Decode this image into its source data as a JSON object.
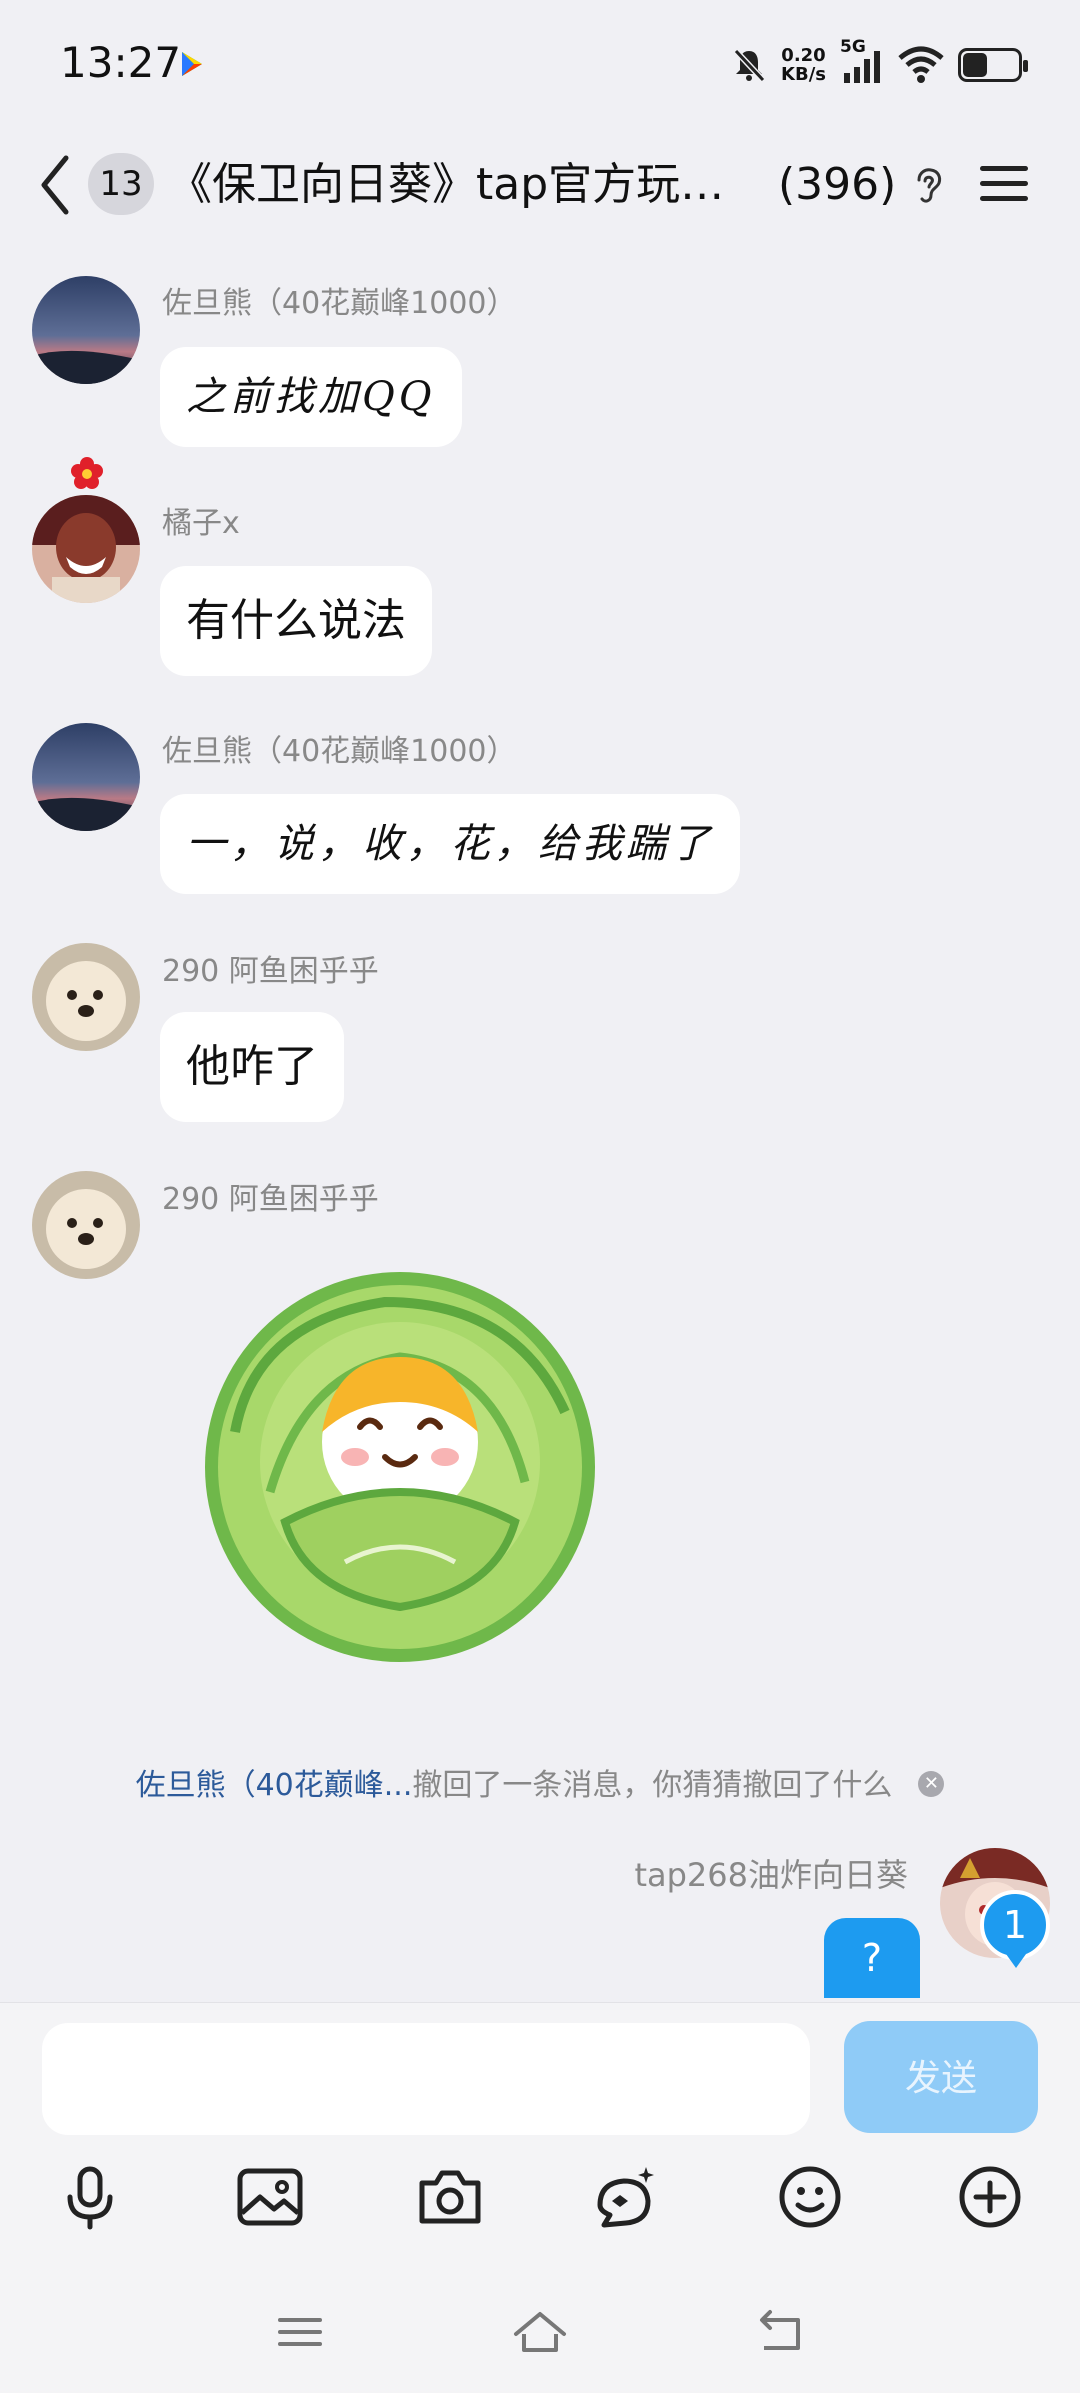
{
  "status_bar": {
    "time": "13:27",
    "net_speed_value": "0.20",
    "net_speed_unit": "KB/s",
    "network_type": "5G",
    "battery_level": 0.45
  },
  "header": {
    "unread_count": "13",
    "title": "《保卫向日葵》tap官方玩家…",
    "member_count": "(396)"
  },
  "messages": [
    {
      "sender": "佐旦熊（40花巅峰1000）",
      "text": "之前找加QQ"
    },
    {
      "sender": "橘子x",
      "text": "有什么说法"
    },
    {
      "sender": "佐旦熊（40花巅峰1000）",
      "text": "一，说，收，花，给我踹了"
    },
    {
      "sender": "290 阿鱼困乎乎",
      "text": "他咋了"
    },
    {
      "sender": "290 阿鱼困乎乎",
      "sticker": "cabbage-shiba-sticker"
    }
  ],
  "recall_notice": {
    "who": "佐旦熊（40花巅峰...",
    "text": "撤回了一条消息，你猜猜撤回了什么"
  },
  "self_message": {
    "sender": "tap268油炸向日葵",
    "text": "?",
    "new_message_badge": "1"
  },
  "composer": {
    "placeholder": "",
    "send_label": "发送"
  },
  "toolbar_icons": [
    "microphone-icon",
    "image-icon",
    "camera-icon",
    "magic-pen-icon",
    "emoji-icon",
    "plus-icon"
  ],
  "colors": {
    "accent": "#1D9BF0",
    "send_disabled": "#8FCBF7",
    "background": "#F0F0F4"
  }
}
